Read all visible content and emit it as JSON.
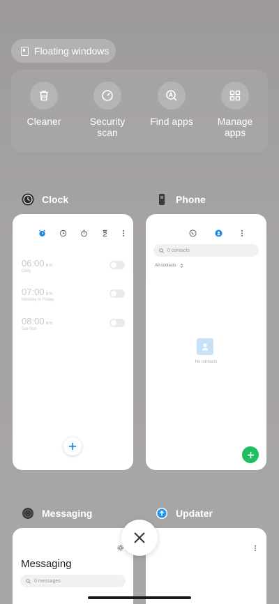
{
  "floating_windows": {
    "label": "Floating windows",
    "icon": "floating-window-icon"
  },
  "tools": [
    {
      "label_line1": "Cleaner",
      "label_line2": "",
      "icon": "trash-icon"
    },
    {
      "label_line1": "Security",
      "label_line2": "scan",
      "icon": "security-scan-icon"
    },
    {
      "label_line1": "Find apps",
      "label_line2": "",
      "icon": "find-apps-icon"
    },
    {
      "label_line1": "Manage",
      "label_line2": "apps",
      "icon": "manage-apps-icon"
    }
  ],
  "apps": {
    "clock": {
      "name": "Clock",
      "alarms": [
        {
          "time": "06:00",
          "ampm": "am",
          "sub": "Daily"
        },
        {
          "time": "07:00",
          "ampm": "am",
          "sub": "Monday to Friday"
        },
        {
          "time": "08:00",
          "ampm": "am",
          "sub": "Sat-Sun"
        }
      ],
      "accent": "#1e88e5"
    },
    "phone": {
      "name": "Phone",
      "search_placeholder": "0 contacts",
      "filter": "All contacts",
      "empty_text": "No contacts",
      "fab_color": "#1dbf61"
    },
    "messaging": {
      "name": "Messaging",
      "title": "Messaging",
      "search_placeholder": "0 messages"
    },
    "updater": {
      "name": "Updater",
      "accent": "#2196f3"
    }
  }
}
